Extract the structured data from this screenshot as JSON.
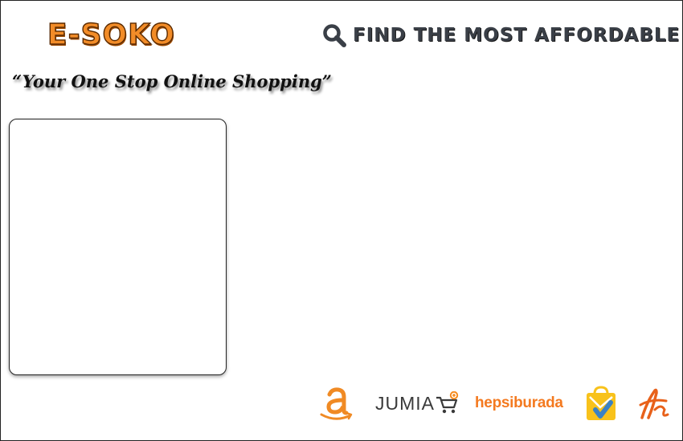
{
  "header": {
    "logo_text": "E-SOKO",
    "tagline": "“Your One Stop Online Shopping”",
    "search": {
      "icon": "search-icon",
      "label": "Find the most affordable"
    }
  },
  "partners": [
    {
      "id": "amazon",
      "icon": "amazon-logo"
    },
    {
      "id": "jumia",
      "text": "JUMIA",
      "icon": "jumia-logo"
    },
    {
      "id": "hepsiburada",
      "text": "hepsiburada",
      "icon": "hepsiburada-logo"
    },
    {
      "id": "shopping-bag",
      "icon": "shopping-bag-logo"
    },
    {
      "id": "aliexpress",
      "icon": "aliexpress-logo"
    }
  ],
  "colors": {
    "brand_orange": "#f28c28",
    "search_text": "#3a3f47",
    "hepsiburada_orange": "#f47a20",
    "amazon_orange": "#f08a24",
    "jumia_orange": "#f68b1e",
    "bag_yellow": "#f8c21b",
    "bag_blue": "#3b82c4",
    "ali_orange": "#e8611a"
  }
}
